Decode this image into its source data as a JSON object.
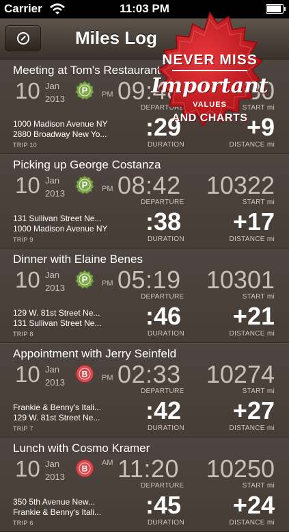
{
  "status_bar": {
    "carrier": "Carrier",
    "time": "11:03 PM"
  },
  "nav": {
    "title": "Miles Log",
    "gauge_button": "gauge-icon"
  },
  "labels": {
    "departure": "DEPARTURE",
    "start": "START mi",
    "duration": "DURATION",
    "distance": "DISTANCE mi"
  },
  "colors": {
    "parking_green": "#7fa84a",
    "business_red": "#d84a4e",
    "seal_red": "#c8181e",
    "background": "#4a4038"
  },
  "trips": [
    {
      "title": "Meeting at Tom's Restaurant",
      "day": "10",
      "month": "Jan",
      "year": "2013",
      "badge": "P",
      "ampm": "PM",
      "departure": "09:48",
      "start": "10330",
      "from": "1000 Madison Avenue NY",
      "to": "2880 Broadway New Yo...",
      "trip": "TRIP 10",
      "duration": ":29",
      "distance": "+9"
    },
    {
      "title": "Picking up George Costanza",
      "day": "10",
      "month": "Jan",
      "year": "2013",
      "badge": "P",
      "ampm": "PM",
      "departure": "08:42",
      "start": "10322",
      "from": "131 Sullivan Street Ne...",
      "to": "1000 Madison Avenue NY",
      "trip": "TRIP 9",
      "duration": ":38",
      "distance": "+17"
    },
    {
      "title": "Dinner with Elaine Benes",
      "day": "10",
      "month": "Jan",
      "year": "2013",
      "badge": "P",
      "ampm": "PM",
      "departure": "05:19",
      "start": "10301",
      "from": "129 W. 81st Street Ne...",
      "to": "131 Sullivan Street Ne...",
      "trip": "TRIP 8",
      "duration": ":46",
      "distance": "+21"
    },
    {
      "title": "Appointment with Jerry Seinfeld",
      "day": "10",
      "month": "Jan",
      "year": "2013",
      "badge": "B",
      "ampm": "PM",
      "departure": "02:33",
      "start": "10274",
      "from": "Frankie & Benny's Itali...",
      "to": "129 W. 81st Street Ne...",
      "trip": "TRIP 7",
      "duration": ":42",
      "distance": "+27"
    },
    {
      "title": "Lunch with Cosmo Kramer",
      "day": "10",
      "month": "Jan",
      "year": "2013",
      "badge": "B",
      "ampm": "AM",
      "departure": "11:20",
      "start": "10250",
      "from": "350 5th Avenue New...",
      "to": "Frankie & Benny's Itali...",
      "trip": "TRIP 6",
      "duration": ":45",
      "distance": "+24"
    }
  ],
  "promo": {
    "line1": "NEVER MISS",
    "line2": "Important",
    "line3": "VALUES",
    "line4": "AND CHARTS"
  }
}
